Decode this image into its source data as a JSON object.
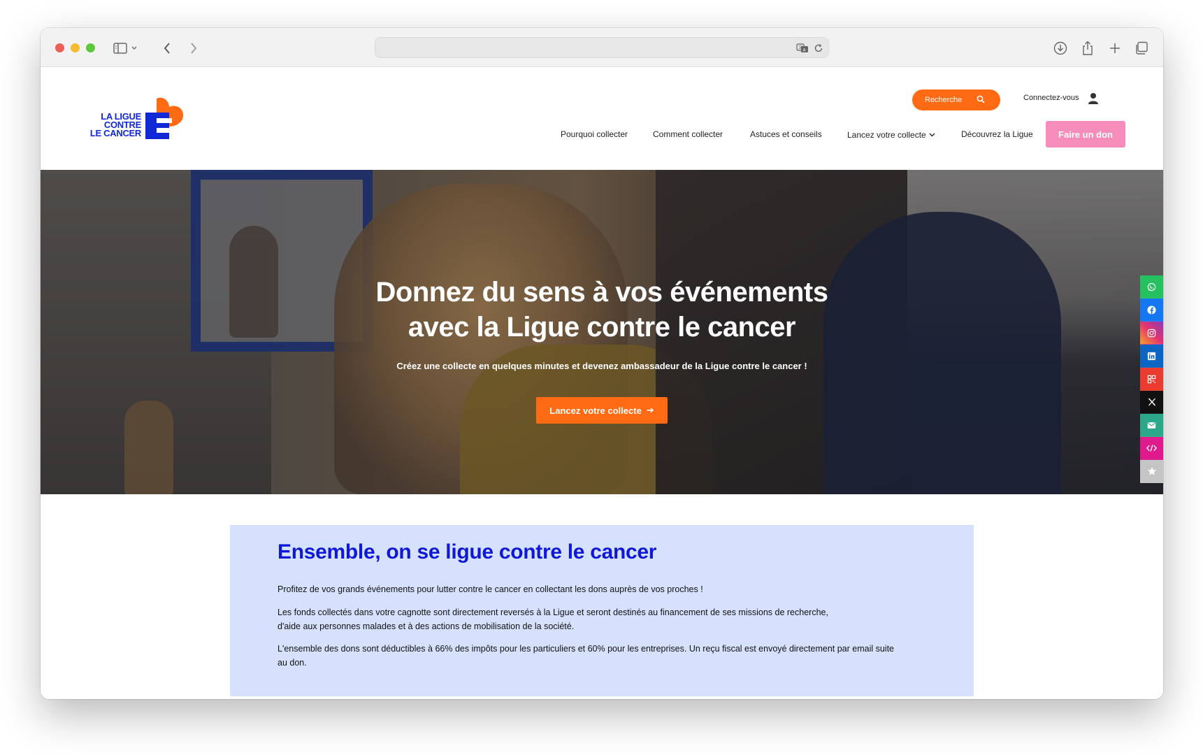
{
  "browser": {
    "address": ""
  },
  "header": {
    "logo": {
      "line1": "LA LIGUE",
      "line2": "CONTRE",
      "line3": "LE CANCER"
    },
    "search_label": "Recherche",
    "login_label": "Connectez-vous",
    "nav": [
      {
        "label": "Pourquoi collecter"
      },
      {
        "label": "Comment collecter"
      },
      {
        "label": "Astuces et conseils"
      },
      {
        "label": "Lancez votre collecte"
      },
      {
        "label": "Découvrez la Ligue"
      }
    ],
    "donate_label": "Faire un don"
  },
  "hero": {
    "title_line1": "Donnez du sens à vos événements",
    "title_line2": "avec la Ligue contre le cancer",
    "subtitle": "Créez une collecte en quelques minutes et devenez ambassadeur de la Ligue contre le cancer !",
    "cta_label": "Lancez votre collecte",
    "cta_arrow": "➔"
  },
  "share": [
    {
      "icon": "whatsapp-icon",
      "color": "#25c05f"
    },
    {
      "icon": "facebook-icon",
      "color": "#1677f2"
    },
    {
      "icon": "instagram-icon",
      "color": "#e3346f"
    },
    {
      "icon": "linkedin-icon",
      "color": "#0a66c2"
    },
    {
      "icon": "qr-code-icon",
      "color": "#ea3b2e"
    },
    {
      "icon": "x-icon",
      "color": "#111111"
    },
    {
      "icon": "email-icon",
      "color": "#2aa889"
    },
    {
      "icon": "embed-code-icon",
      "color": "#e0198d"
    },
    {
      "icon": "bookmark-star-icon",
      "color": "#c5c5c5"
    }
  ],
  "info": {
    "title": "Ensemble, on se ligue contre le cancer",
    "p1": "Profitez de vos grands événements pour lutter contre le cancer en collectant les dons auprès de vos proches !",
    "p2_line1": "Les fonds collectés dans votre cagnotte sont directement reversés à la Ligue et seront destinés au financement de ses missions de recherche,",
    "p2_line2": "d'aide aux personnes malades et à des actions de mobilisation de la société.",
    "p3_line1": "L'ensemble des dons sont déductibles à 66% des impôts pour les particuliers et 60% pour les entreprises. Un reçu fiscal est envoyé directement par email suite",
    "p3_line2": "au don."
  },
  "colors": {
    "brand_blue": "#1028d6",
    "brand_orange": "#ff6a12",
    "donate_pink": "#f58cb9",
    "info_bg": "#d6e2fd"
  }
}
